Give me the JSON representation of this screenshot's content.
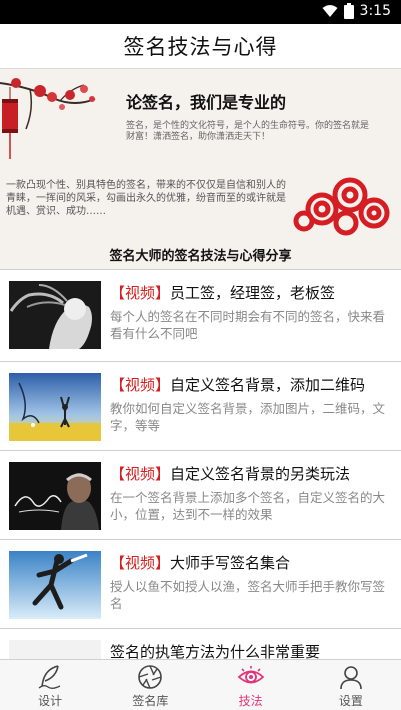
{
  "status_bar": {
    "time": "3:15"
  },
  "header": {
    "title": "签名技法与心得"
  },
  "banner": {
    "heading": "论签名，我们是专业的",
    "sub": "签名，是个性的文化符号，是个人的生命符号。你的签名就是财富！潇洒签名，助你潇洒走天下！",
    "body": "一款凸现个性、别具特色的签名，带来的不仅仅是自信和别人的青睐，一挥间的风采，勾画出永久的优雅，纷音而至的或许就是机遇、赏识、成功……",
    "cta": "签名大师的签名技法与心得分享"
  },
  "articles": [
    {
      "tag": "【视频】",
      "title": "员工签，经理签，老板签",
      "desc": "每个人的签名在不同时期会有不同的签名，快来看看有什么不同吧"
    },
    {
      "tag": "【视频】",
      "title": "自定义签名背景，添加二维码",
      "desc": "教你如何自定义签名背景，添加图片，二维码，文字，等等"
    },
    {
      "tag": "【视频】",
      "title": "自定义签名背景的另类玩法",
      "desc": "在一个签名背景上添加多个签名，自定义签名的大小，位置，达到不一样的效果"
    },
    {
      "tag": "【视频】",
      "title": "大师手写签名集合",
      "desc": "授人以鱼不如授人以渔，签名大师手把手教你写签名"
    },
    {
      "tag": "",
      "title": "签名的执笔方法为什么非常重要",
      "desc": ""
    }
  ],
  "tabs": [
    {
      "label": "设计",
      "icon": "feather-pen-icon"
    },
    {
      "label": "签名库",
      "icon": "aperture-icon"
    },
    {
      "label": "技法",
      "icon": "eye-icon"
    },
    {
      "label": "设置",
      "icon": "user-icon"
    }
  ],
  "colors": {
    "accent": "#e2347a",
    "tag_red": "#d81e1e"
  }
}
